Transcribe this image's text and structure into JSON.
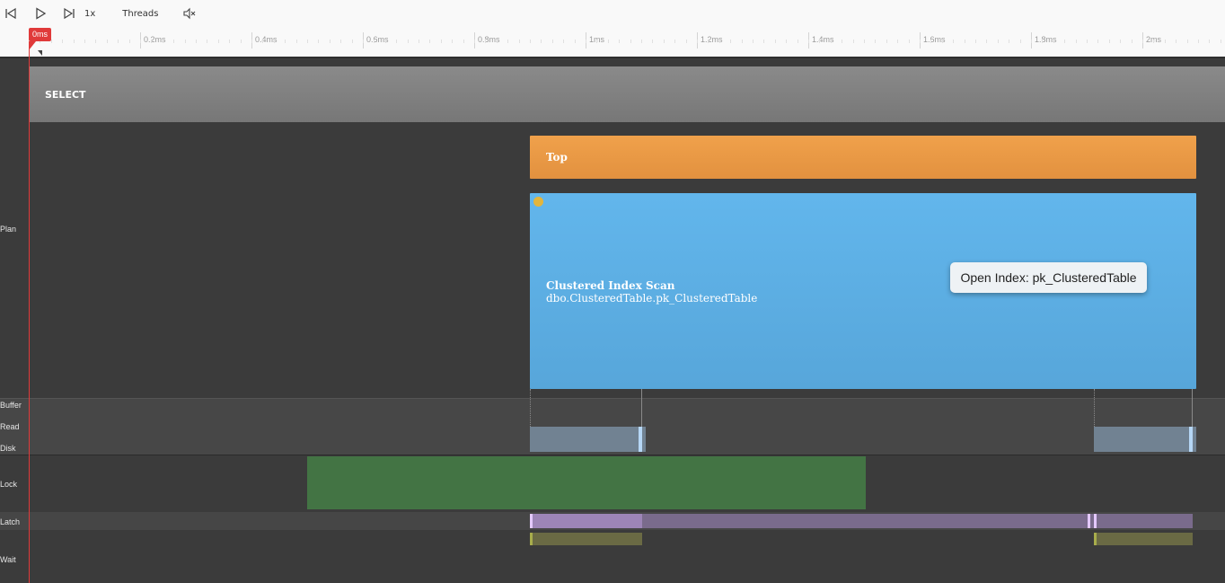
{
  "toolbar": {
    "speed_label": "1x",
    "threads_label": "Threads",
    "icons": [
      "skip-to-start-icon",
      "play-icon",
      "skip-to-end-icon",
      "mute-icon"
    ]
  },
  "ruler": {
    "playhead_label": "0ms",
    "ticks": [
      "0.2ms",
      "0.4ms",
      "0.6ms",
      "0.8ms",
      "1ms",
      "1.2ms",
      "1.4ms",
      "1.6ms",
      "1.8ms",
      "2ms"
    ]
  },
  "rows": {
    "plan": "Plan",
    "buffer": "Buffer",
    "read": "Read",
    "disk": "Disk",
    "lock": "Lock",
    "latch": "Latch",
    "wait": "Wait"
  },
  "plan": {
    "select": "SELECT",
    "top": "Top",
    "scan_title": "Clustered Index Scan",
    "scan_subtitle": "dbo.ClusteredTable.pk_ClusteredTable"
  },
  "tooltip": {
    "label": "Open Index: pk_ClusteredTable"
  },
  "colors": {
    "playhead": "#e03a3a",
    "select": "#808080",
    "top": "#e9994a",
    "scan": "#5fb0e6",
    "lock": "#437444",
    "latch": "#7a6b8c",
    "wait": "#6a6a44",
    "io": "#718292"
  }
}
